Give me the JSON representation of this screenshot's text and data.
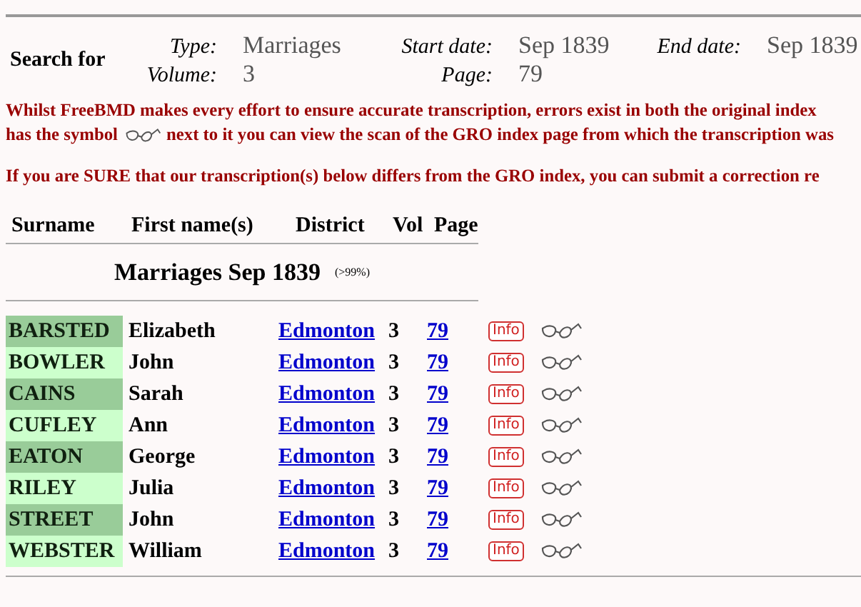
{
  "search": {
    "heading": "Search for",
    "fields": [
      {
        "label": "Type:",
        "value": "Marriages"
      },
      {
        "label": "Start date:",
        "value": "Sep 1839"
      },
      {
        "label": "End date:",
        "value": "Sep 1839"
      },
      {
        "label": "Volume:",
        "value": "3"
      },
      {
        "label": "Page:",
        "value": "79"
      }
    ]
  },
  "notice": {
    "line_1": "Whilst FreeBMD makes every effort to ensure accurate transcription, errors exist in both the original index",
    "line_2_before": "has the symbol",
    "line_2_after": "next to it you can view the scan of the GRO index page from which the transcription was",
    "line_3": "If you are SURE that our transcription(s) below differs from the GRO index, you can submit a correction re"
  },
  "table": {
    "columns": [
      "Surname",
      "First name(s)",
      "District",
      "Vol",
      "Page"
    ],
    "section_title": "Marriages Sep 1839",
    "section_accuracy": "(>99%)",
    "rows": [
      {
        "surname": "BARSTED",
        "first_names": "Elizabeth",
        "district": "Edmonton",
        "vol": "3",
        "page": "79",
        "info": "Info"
      },
      {
        "surname": "BOWLER",
        "first_names": "John",
        "district": "Edmonton",
        "vol": "3",
        "page": "79",
        "info": "Info"
      },
      {
        "surname": "CAINS",
        "first_names": "Sarah",
        "district": "Edmonton",
        "vol": "3",
        "page": "79",
        "info": "Info"
      },
      {
        "surname": "CUFLEY",
        "first_names": "Ann",
        "district": "Edmonton",
        "vol": "3",
        "page": "79",
        "info": "Info"
      },
      {
        "surname": "EATON",
        "first_names": "George",
        "district": "Edmonton",
        "vol": "3",
        "page": "79",
        "info": "Info"
      },
      {
        "surname": "RILEY",
        "first_names": "Julia",
        "district": "Edmonton",
        "vol": "3",
        "page": "79",
        "info": "Info"
      },
      {
        "surname": "STREET",
        "first_names": "John",
        "district": "Edmonton",
        "vol": "3",
        "page": "79",
        "info": "Info"
      },
      {
        "surname": "WEBSTER",
        "first_names": "William",
        "district": "Edmonton",
        "vol": "3",
        "page": "79",
        "info": "Info"
      }
    ]
  }
}
